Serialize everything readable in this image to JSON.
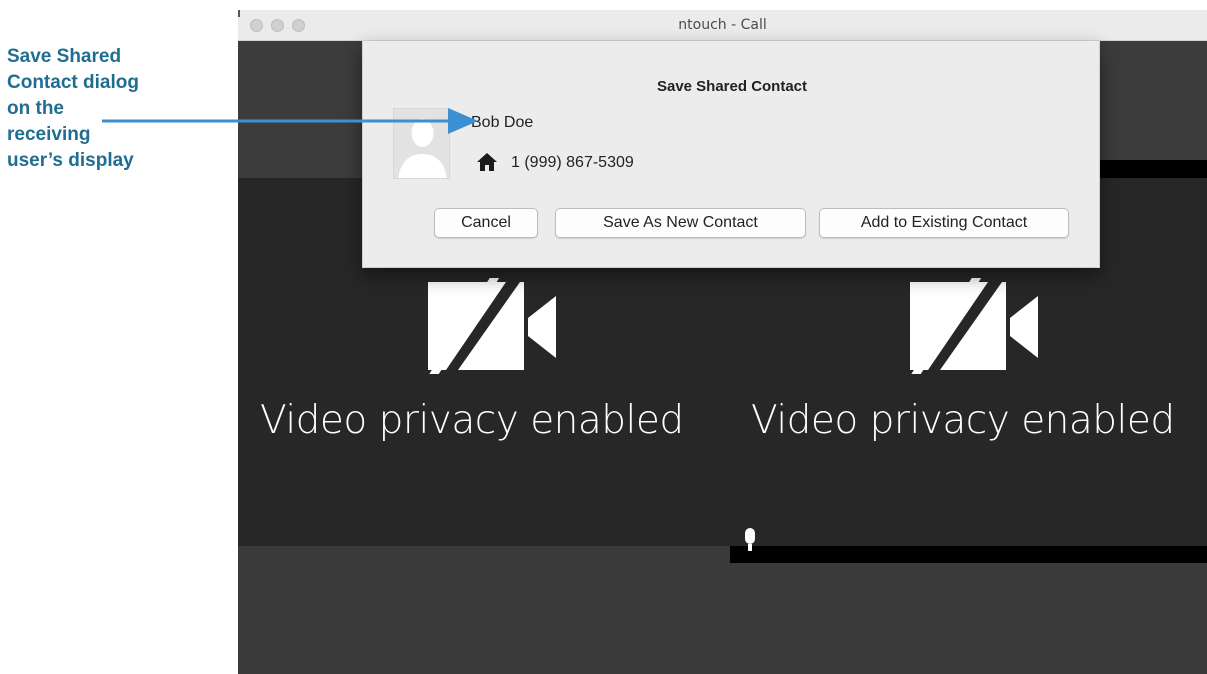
{
  "callout": {
    "lines": [
      "Save Shared",
      "Contact dialog",
      "on the",
      "receiving",
      "user’s display"
    ]
  },
  "window": {
    "title": "ntouch - Call"
  },
  "dialog": {
    "title": "Save Shared Contact",
    "contact_name": "Bob Doe",
    "phone_type_icon": "home-icon",
    "phone": "1 (999) 867-5309",
    "buttons": {
      "cancel": "Cancel",
      "save_new": "Save As New Contact",
      "add_existing": "Add to Existing Contact"
    }
  },
  "call": {
    "remote_privacy_text": "Video privacy enabled",
    "self_privacy_text": "Video privacy enabled",
    "camera_icon": "camera-off-icon",
    "mic_icon": "microphone-icon"
  },
  "colors": {
    "callout": "#1f6e91",
    "arrow": "#3c8fd0",
    "video_bg": "#272727",
    "dialog_bg": "#ececec"
  }
}
